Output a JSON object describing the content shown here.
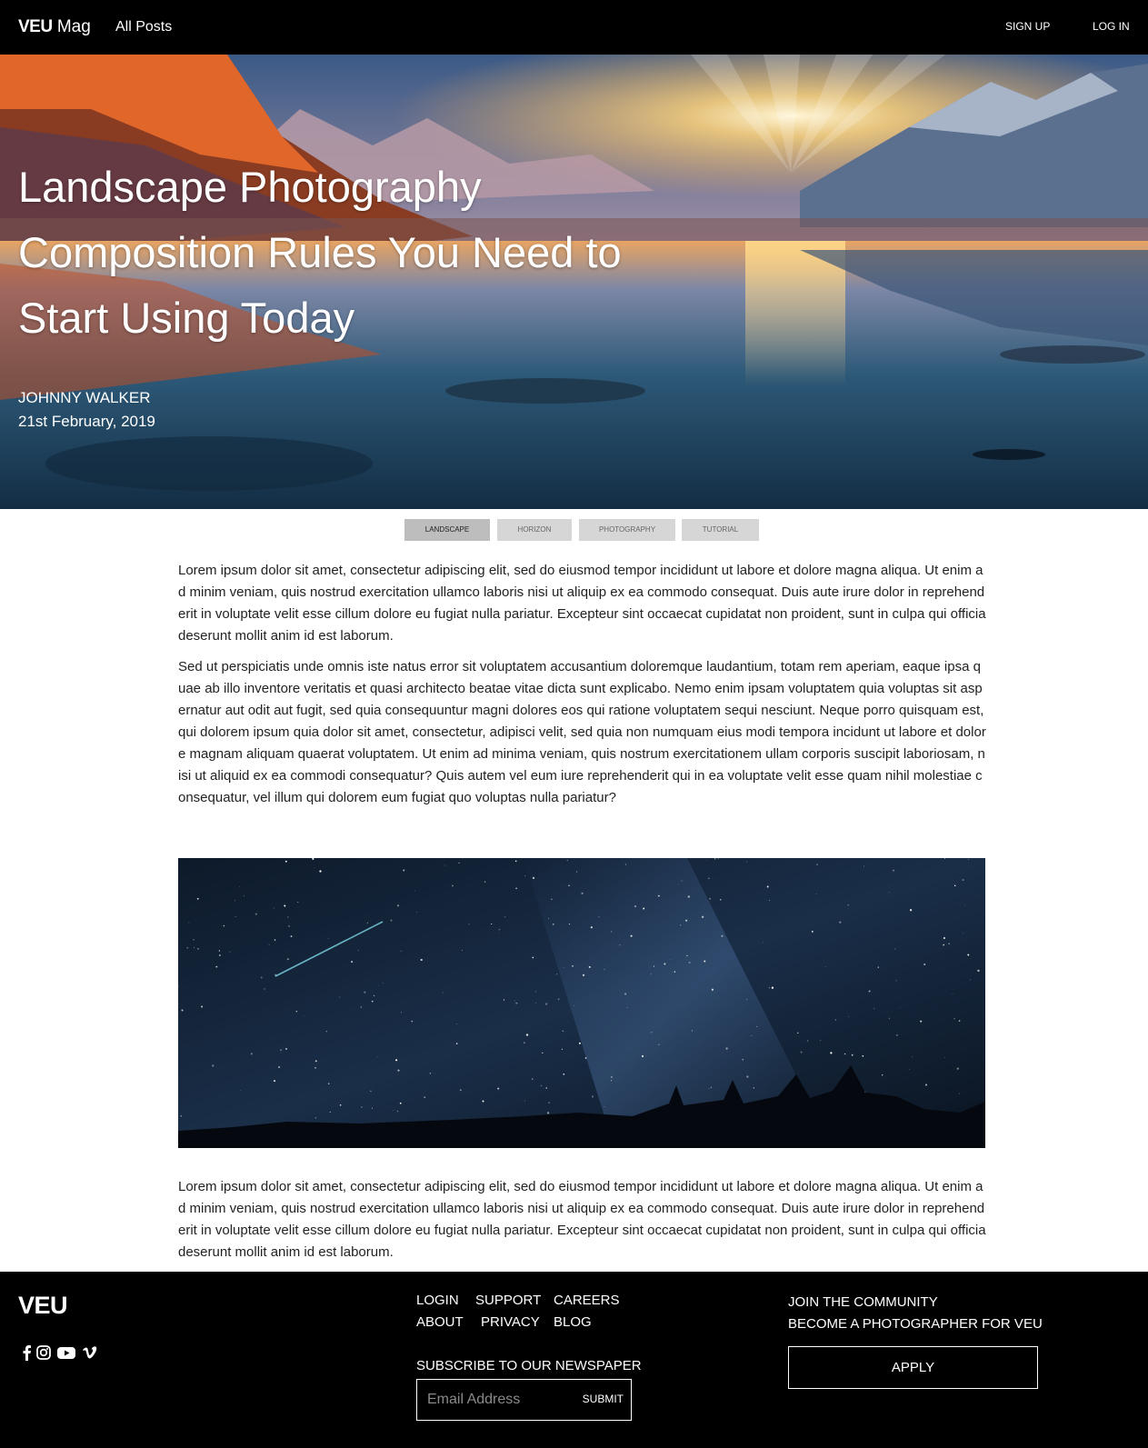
{
  "header": {
    "brand_strong": "VEU",
    "brand_rest": " Mag",
    "all_posts": "All Posts",
    "sign_up": "SIGN UP",
    "log_in": "LOG IN"
  },
  "hero": {
    "title": "Landscape Photography Composition Rules You Need to Start Using Today",
    "author": "JOHNNY WALKER",
    "date": "21st February, 2019"
  },
  "tags": [
    {
      "label": "LANDSCAPE",
      "active": true
    },
    {
      "label": "HORIZON",
      "active": false
    },
    {
      "label": "PHOTOGRAPHY",
      "active": false
    },
    {
      "label": "TUTORIAL",
      "active": false
    }
  ],
  "article": {
    "paragraph_1": "Lorem ipsum dolor sit amet, consectetur adipiscing elit, sed do eiusmod tempor incididunt ut labore et dolore magna aliqua. Ut enim ad minim veniam, quis nostrud exercitation ullamco laboris nisi ut aliquip ex ea commodo consequat. Duis aute irure dolor in reprehenderit in voluptate velit esse cillum dolore eu fugiat nulla pariatur. Excepteur sint occaecat cupidatat non proident, sunt in culpa qui officia deserunt mollit anim id est laborum.",
    "paragraph_2": "Sed ut perspiciatis unde omnis iste natus error sit voluptatem accusantium doloremque laudantium, totam rem aperiam, eaque ipsa quae ab illo inventore veritatis et quasi architecto beatae vitae dicta sunt explicabo. Nemo enim ipsam voluptatem quia voluptas sit aspernatur aut odit aut fugit, sed quia consequuntur magni dolores eos qui ratione voluptatem sequi nesciunt. Neque porro quisquam est, qui dolorem ipsum quia dolor sit amet, consectetur, adipisci velit, sed quia non numquam eius modi tempora incidunt ut labore et dolore magnam aliquam quaerat voluptatem. Ut enim ad minima veniam, quis nostrum exercitationem ullam corporis suscipit laboriosam, nisi ut aliquid ex ea commodi consequatur? Quis autem vel eum iure reprehenderit qui in ea voluptate velit esse quam nihil molestiae consequatur, vel illum qui dolorem eum fugiat quo voluptas nulla pariatur?",
    "paragraph_3": "Lorem ipsum dolor sit amet, consectetur adipiscing elit, sed do eiusmod tempor incididunt ut labore et dolore magna aliqua. Ut enim ad minim veniam, quis nostrud exercitation ullamco laboris nisi ut aliquip ex ea commodo consequat. Duis aute irure dolor in reprehenderit in voluptate velit esse cillum dolore eu fugiat nulla pariatur. Excepteur sint occaecat cupidatat non proident, sunt in culpa qui officia deserunt mollit anim id est laborum."
  },
  "footer": {
    "logo": "VEU",
    "social_icons": [
      "facebook-icon",
      "instagram-icon",
      "youtube-icon",
      "vimeo-icon"
    ],
    "links": {
      "login": "LOGIN",
      "support": "SUPPORT",
      "careers": "CAREERS",
      "about": "ABOUT",
      "privacy": "PRIVACY",
      "blog": "BLOG"
    },
    "subscribe_label": "SUBSCRIBE TO OUR NEWSPAPER",
    "email_placeholder": "Email Address",
    "submit_label": "SUBMIT",
    "join_line_1": "JOIN THE COMMUNITY",
    "join_line_2": "BECOME A PHOTOGRAPHER FOR VEU",
    "apply_label": "APPLY"
  },
  "colors": {
    "header_bg": "#000000",
    "footer_bg": "#000000",
    "tag_bg": "#d6d6d6",
    "tag_active_bg": "#bdbdbd",
    "body_text": "#222222"
  }
}
